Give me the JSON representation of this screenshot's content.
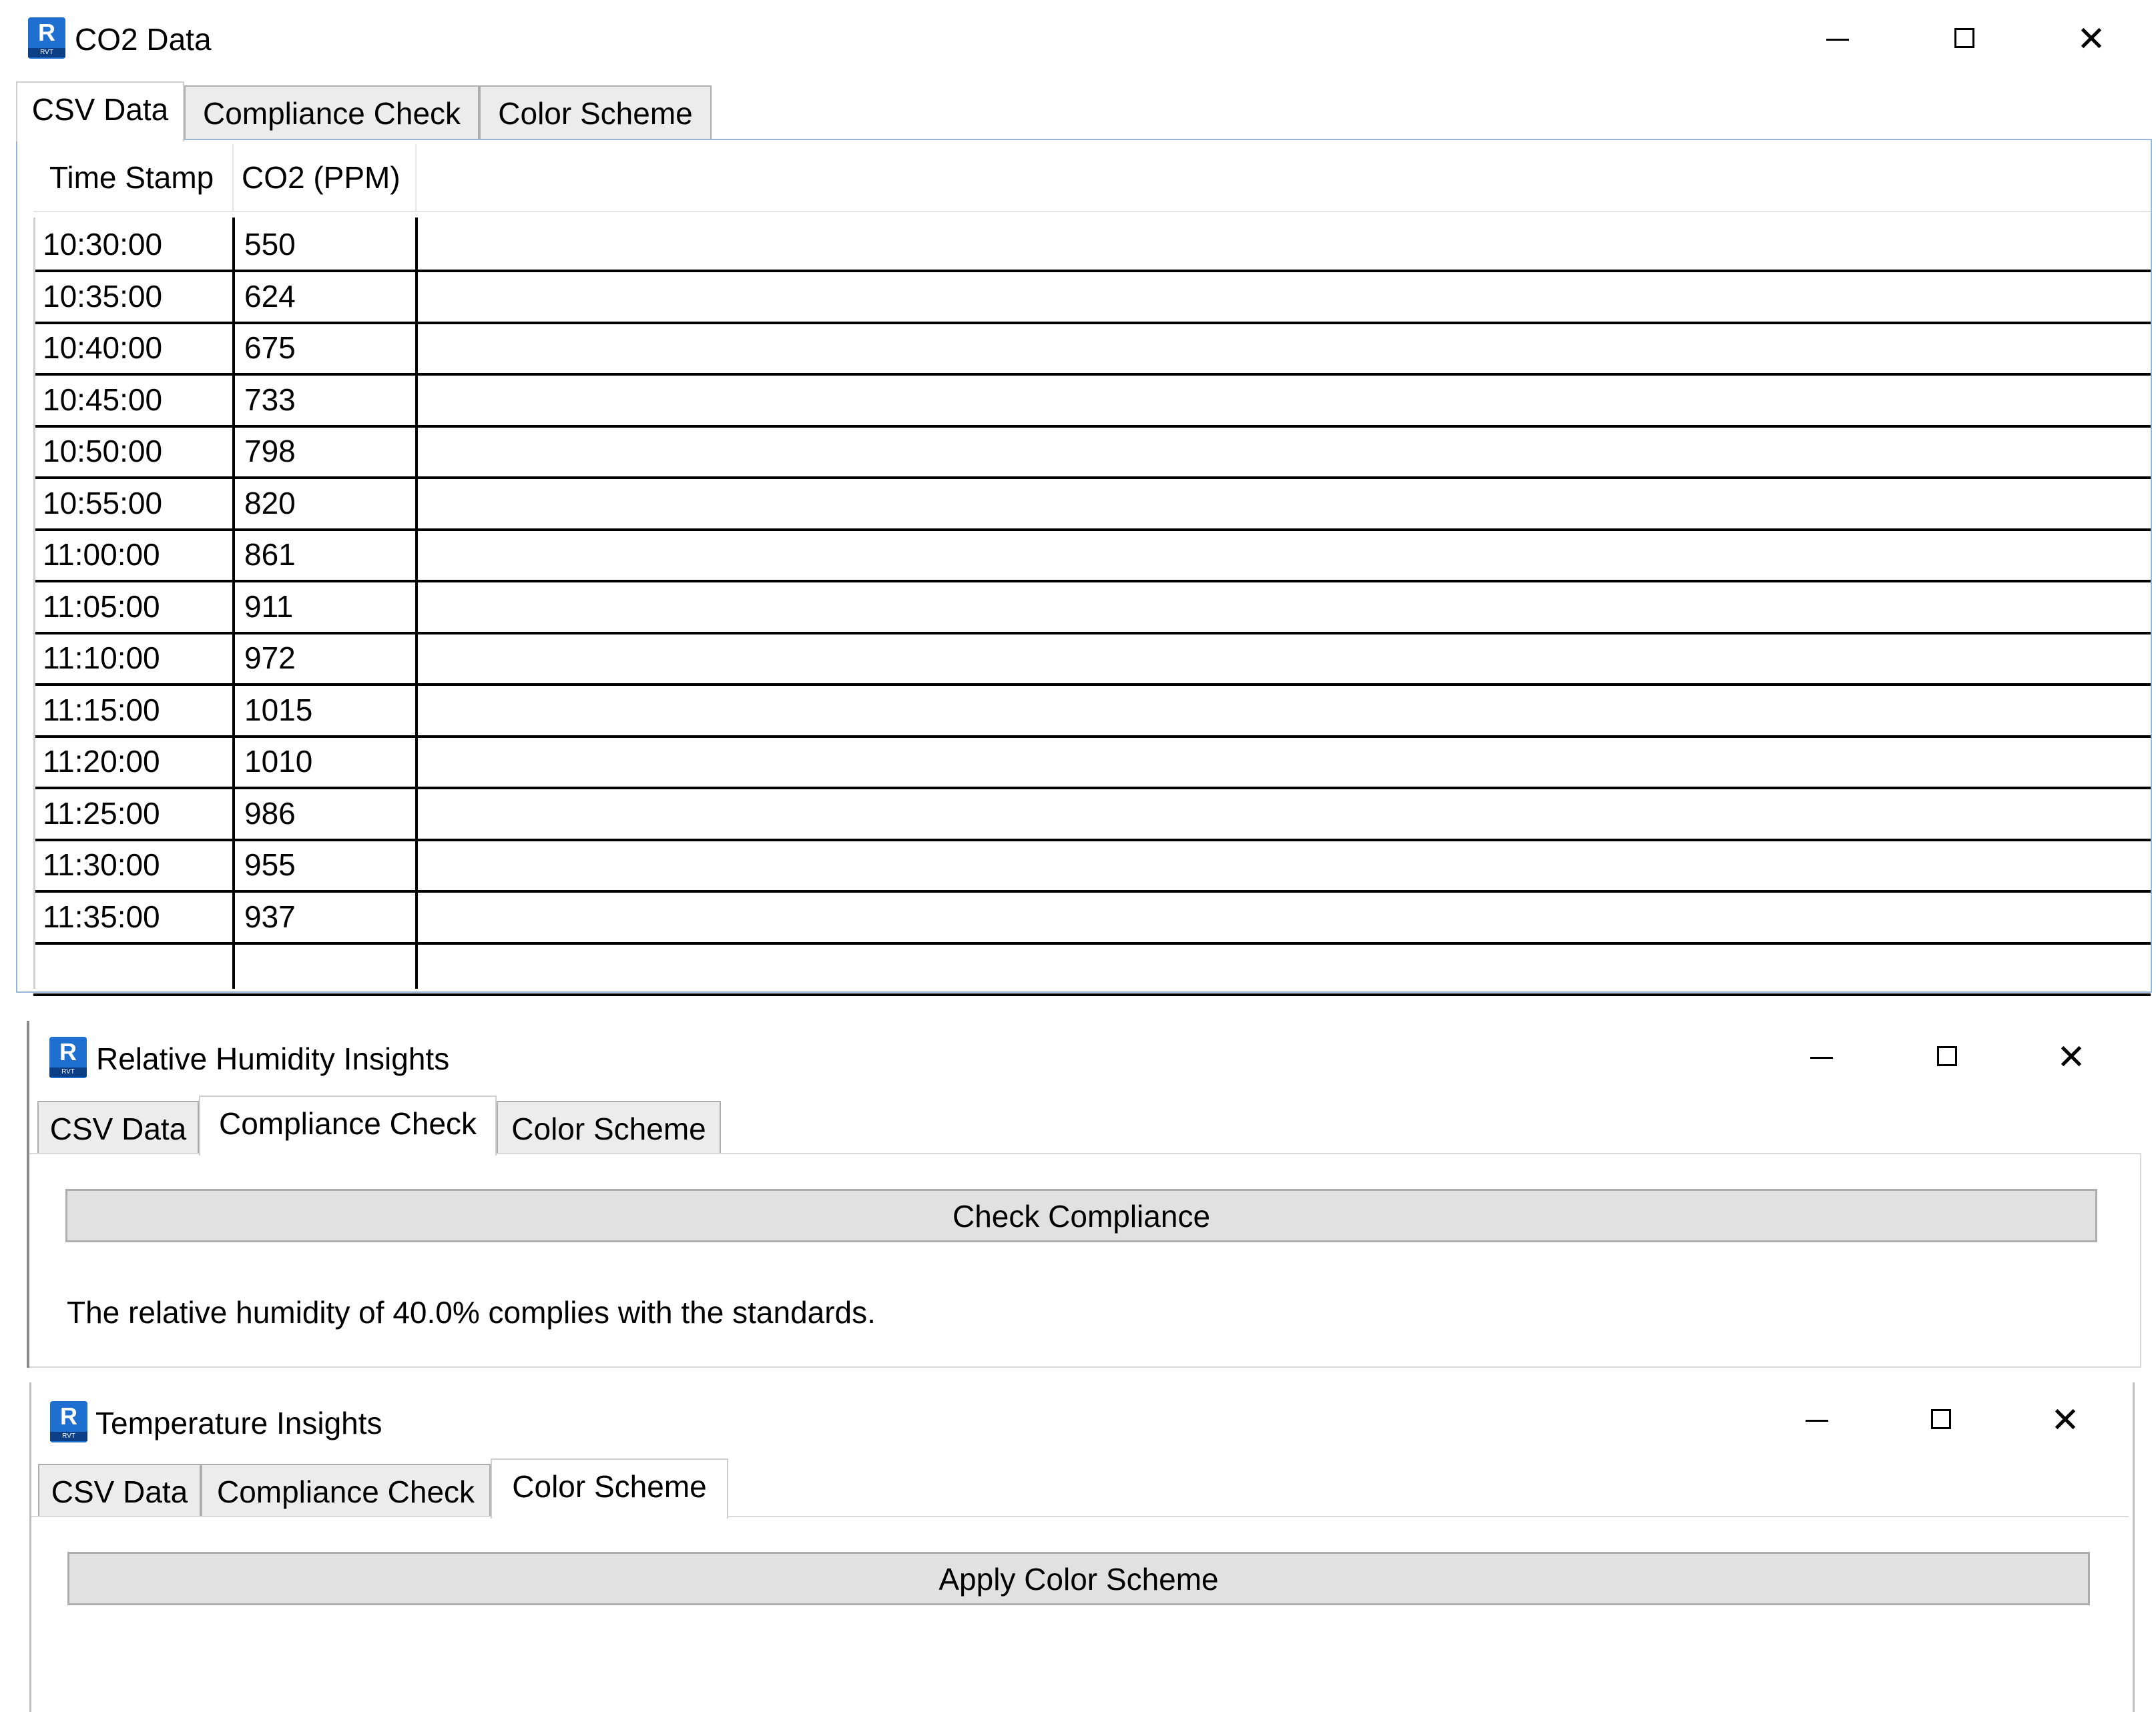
{
  "tab_labels": [
    "CSV Data",
    "Compliance Check",
    "Color Scheme"
  ],
  "co2_window": {
    "title": "CO2 Data",
    "active_tab": "CSV Data",
    "grid": {
      "headers": [
        "Time Stamp",
        "CO2 (PPM)"
      ],
      "rows": [
        [
          "10:30:00",
          "550"
        ],
        [
          "10:35:00",
          "624"
        ],
        [
          "10:40:00",
          "675"
        ],
        [
          "10:45:00",
          "733"
        ],
        [
          "10:50:00",
          "798"
        ],
        [
          "10:55:00",
          "820"
        ],
        [
          "11:00:00",
          "861"
        ],
        [
          "11:05:00",
          "911"
        ],
        [
          "11:10:00",
          "972"
        ],
        [
          "11:15:00",
          "1015"
        ],
        [
          "11:20:00",
          "1010"
        ],
        [
          "11:25:00",
          "986"
        ],
        [
          "11:30:00",
          "955"
        ],
        [
          "11:35:00",
          "937"
        ],
        [
          "",
          ""
        ]
      ]
    }
  },
  "humidity_window": {
    "title": "Relative Humidity Insights",
    "active_tab": "Compliance Check",
    "button_label": "Check Compliance",
    "message": "The relative humidity of 40.0% complies with the standards."
  },
  "temperature_window": {
    "title": "Temperature Insights",
    "active_tab": "Color Scheme",
    "button_label": "Apply Color Scheme"
  },
  "window_controls": {
    "minimize_icon": "minimize-icon",
    "maximize_icon": "maximize-icon",
    "close_icon": "close-icon"
  },
  "colors": {
    "app_icon": "#1f6fd1",
    "button_bg": "#e1e1e1",
    "tab_inactive_bg": "#ececec"
  }
}
